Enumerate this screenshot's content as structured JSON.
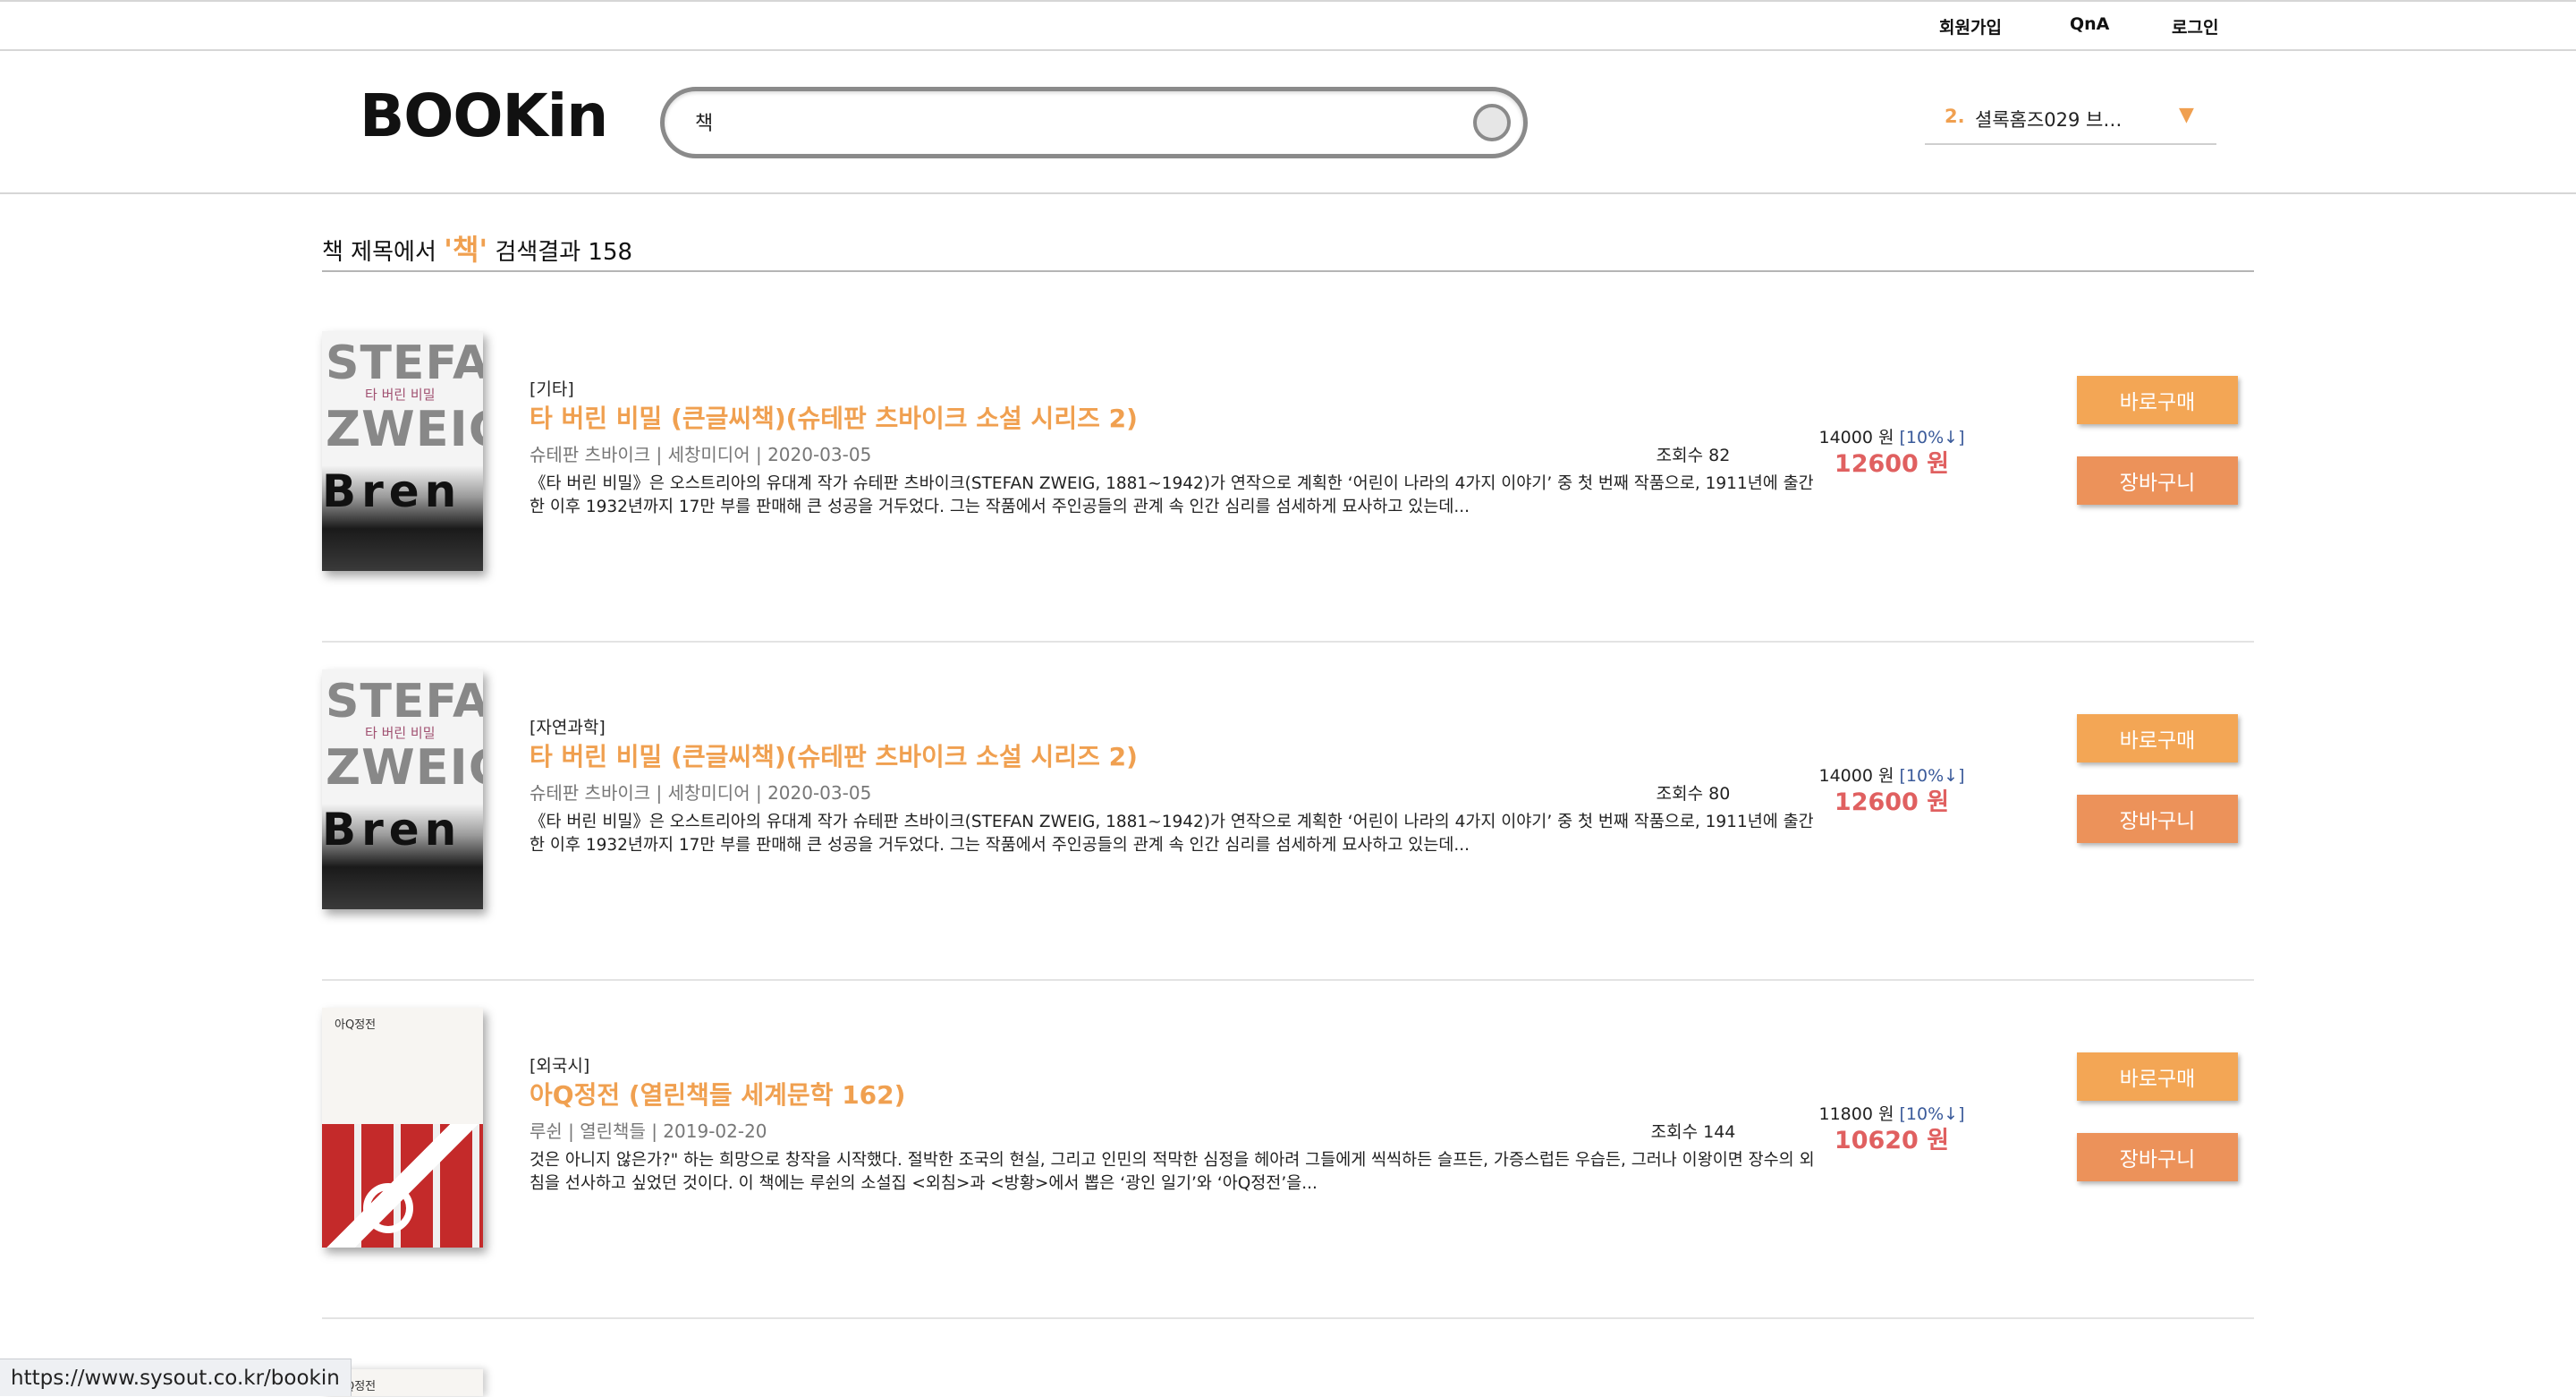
{
  "topnav": {
    "signup": "회원가입",
    "qna": "QnA",
    "login": "로그인"
  },
  "header": {
    "logo": "BOOKin",
    "search": {
      "value": "책",
      "placeholder": ""
    },
    "ranking": {
      "rank": "2.",
      "text": "셜록홈즈029 브…",
      "arrow": "▼"
    }
  },
  "summary": {
    "prefix": "책 제목에서",
    "keyword": "'책'",
    "suffix": "검색결과 158"
  },
  "results": [
    {
      "cover_lines": [
        "STEFAN",
        "타 버린 비밀",
        "ZWEIG",
        "Bren"
      ],
      "category": "[기타]",
      "title": "타 버린 비밀 (큰글씨책)(슈테판 츠바이크 소설 시리즈 2)",
      "meta": "슈테판 츠바이크 | 세창미디어 | 2020-03-05",
      "description": "《타 버린 비밀》은 오스트리아의 유대계 작가 슈테판 츠바이크(STEFAN ZWEIG, 1881~1942)가 연작으로 계획한 ‘어린이 나라의 4가지 이야기’ 중 첫 번째 작품으로, 1911년에 출간한 이후 1932년까지 17만 부를 판매해 큰 성공을 거두었다. 그는 작품에서 주인공들의 관계 속 인간 심리를 섬세하게 묘사하고 있는데...",
      "views": "조회수 82",
      "price_orig": "14000 원",
      "discount": "[10%↓]",
      "price_sale": "12600 원",
      "buy_label": "바로구매",
      "cart_label": "장바구니"
    },
    {
      "cover_lines": [
        "STEFAN",
        "타 버린 비밀",
        "ZWEIG",
        "Bren"
      ],
      "category": "[자연과학]",
      "title": "타 버린 비밀 (큰글씨책)(슈테판 츠바이크 소설 시리즈 2)",
      "meta": "슈테판 츠바이크 | 세창미디어 | 2020-03-05",
      "description": "《타 버린 비밀》은 오스트리아의 유대계 작가 슈테판 츠바이크(STEFAN ZWEIG, 1881~1942)가 연작으로 계획한 ‘어린이 나라의 4가지 이야기’ 중 첫 번째 작품으로, 1911년에 출간한 이후 1932년까지 17만 부를 판매해 큰 성공을 거두었다. 그는 작품에서 주인공들의 관계 속 인간 심리를 섬세하게 묘사하고 있는데...",
      "views": "조회수 80",
      "price_orig": "14000 원",
      "discount": "[10%↓]",
      "price_sale": "12600 원",
      "buy_label": "바로구매",
      "cart_label": "장바구니"
    },
    {
      "cover_lines": [
        "아Q정전"
      ],
      "category": "[외국시]",
      "title": "아Q정전 (열린책들 세계문학 162)",
      "meta": "루쉰 | 열린책들 | 2019-02-20",
      "description": "것은 아니지 않은가?\" 하는 희망으로 창작을 시작했다. 절박한 조국의 현실, 그리고 인민의 적막한 심정을 헤아려 그들에게 씩씩하든 슬프든, 가증스럽든 우습든, 그러나 이왕이면 장수의 외침을 선사하고 싶었던 것이다. 이 책에는 루쉰의 소설집 <외침>과 <방황>에서 뽑은 ‘광인 일기’와 ‘아Q정전’을...",
      "views": "조회수 144",
      "price_orig": "11800 원",
      "discount": "[10%↓]",
      "price_sale": "10620 원",
      "buy_label": "바로구매",
      "cart_label": "장바구니"
    }
  ],
  "peek_cover": "아Q정전",
  "status_url": "https://www.sysout.co.kr/bookin",
  "colors": {
    "accent": "#f0a050",
    "sale_price": "#e06060",
    "buy_button": "#f3a655",
    "cart_button": "#ec925a"
  }
}
